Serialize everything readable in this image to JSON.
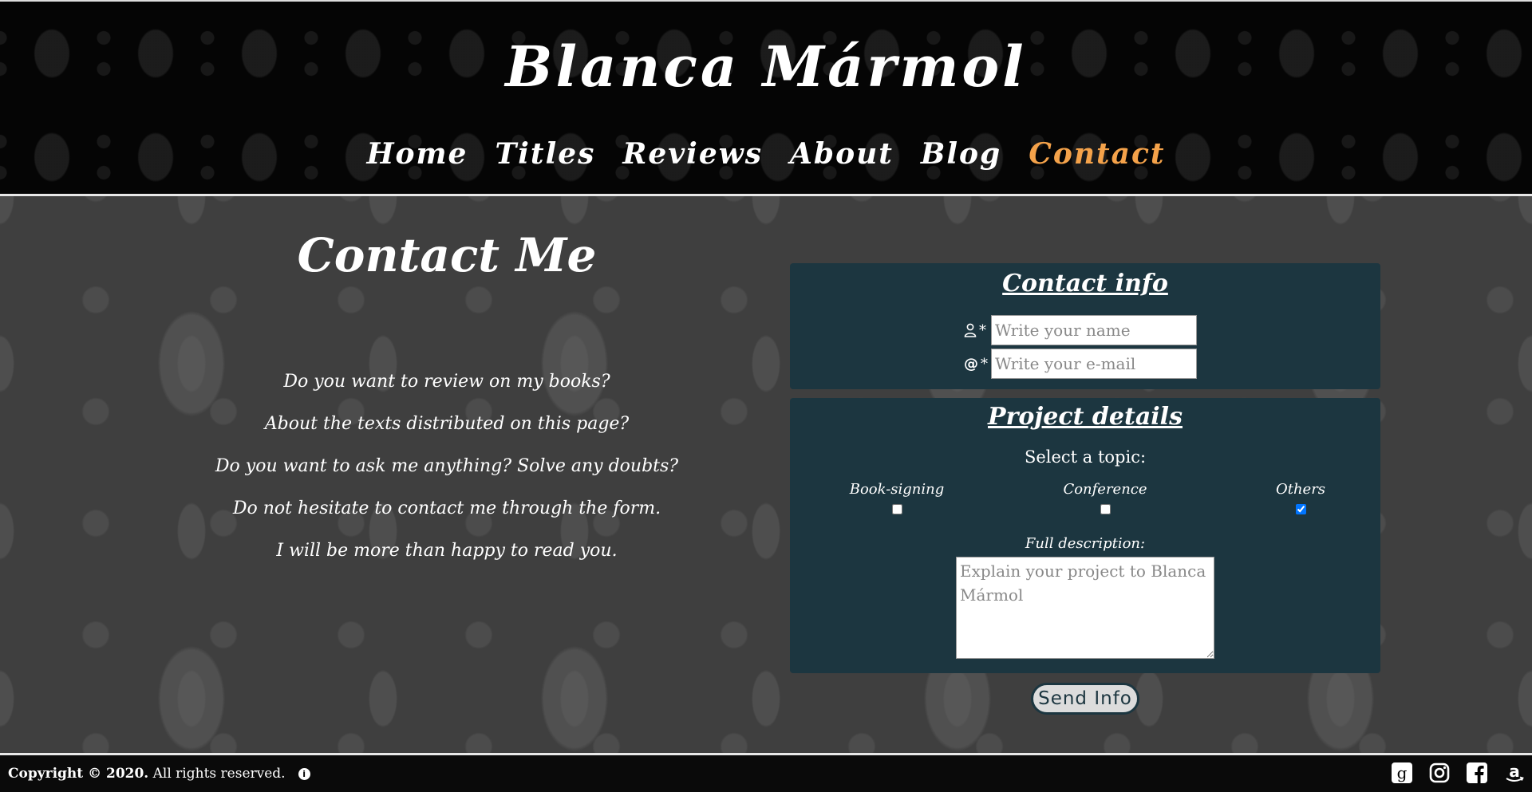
{
  "header": {
    "site_title": "Blanca Mármol",
    "nav": [
      {
        "label": "Home",
        "active": false
      },
      {
        "label": "Titles",
        "active": false
      },
      {
        "label": "Reviews",
        "active": false
      },
      {
        "label": "About",
        "active": false
      },
      {
        "label": "Blog",
        "active": false
      },
      {
        "label": "Contact",
        "active": true
      }
    ],
    "active_color": "#f4a24a"
  },
  "intro": {
    "heading": "Contact Me",
    "lines": [
      "Do you want to review on my books?",
      "About the texts distributed on this page?",
      "Do you want to ask me anything? Solve any doubts?",
      "Do not hesitate to contact me through the form.",
      "I will be more than happy to read you."
    ]
  },
  "contact_info": {
    "title": "Contact info",
    "name": {
      "icon": "user-icon",
      "required_mark": "*",
      "placeholder": "Write your name",
      "value": ""
    },
    "email": {
      "icon": "at-icon",
      "required_mark": "*",
      "placeholder": "Write your e-mail",
      "value": ""
    }
  },
  "project_details": {
    "title": "Project details",
    "topic_prompt": "Select a topic:",
    "topics": [
      {
        "label": "Book-signing",
        "checked": false
      },
      {
        "label": "Conference",
        "checked": false
      },
      {
        "label": "Others",
        "checked": true
      }
    ],
    "description_label": "Full description:",
    "description_placeholder": "Explain your project to Blanca Mármol",
    "description_value": ""
  },
  "send_button": "Send Info",
  "footer": {
    "copyright_bold": "Copyright © 2020.",
    "copyright_rest": "All rights reserved.",
    "info_icon": "info-icon",
    "socials": [
      "goodreads-icon",
      "instagram-icon",
      "facebook-icon",
      "amazon-icon"
    ]
  },
  "colors": {
    "panel": "#1c3640",
    "header_bg": "#050505",
    "main_bg": "#3f3f3f"
  }
}
